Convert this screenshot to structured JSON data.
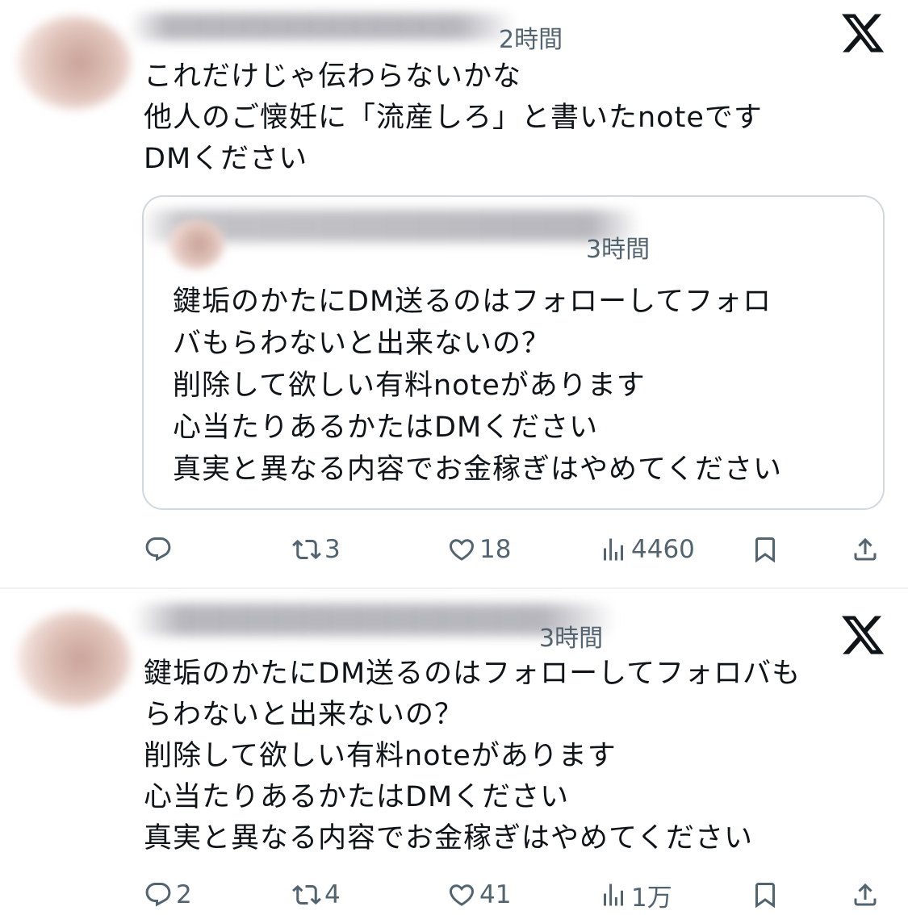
{
  "tweets": [
    {
      "time": "2時間",
      "text_lines": [
        "これだけじゃ伝わらないかな",
        "他人のご懐妊に「流産しろ」と書いたnoteです",
        "DMください"
      ],
      "quote": {
        "time": "3時間",
        "text_lines": [
          "鍵垢のかたにDM送るのはフォローしてフォロ",
          "バもらわないと出来ないの？",
          "削除して欲しい有料noteがあります",
          "心当たりあるかたはDMください",
          "真実と異なる内容でお金稼ぎはやめてください"
        ]
      },
      "actions": {
        "replies": "",
        "reposts": "3",
        "likes": "18",
        "views": "4460"
      }
    },
    {
      "time": "3時間",
      "text_lines": [
        "鍵垢のかたにDM送るのはフォローしてフォロバも",
        "らわないと出来ないの？",
        "削除して欲しい有料noteがあります",
        "心当たりあるかたはDMください",
        "真実と異なる内容でお金稼ぎはやめてください"
      ],
      "actions": {
        "replies": "2",
        "reposts": "4",
        "likes": "41",
        "views": "1万"
      }
    }
  ],
  "icons": {
    "logo": "x-logo-icon",
    "reply": "reply-icon",
    "repost": "repost-icon",
    "like": "heart-icon",
    "views": "views-icon",
    "bookmark": "bookmark-icon",
    "share": "share-icon"
  },
  "colors": {
    "text": "#0f1419",
    "secondary": "#536471",
    "border": "#cfd9de"
  }
}
